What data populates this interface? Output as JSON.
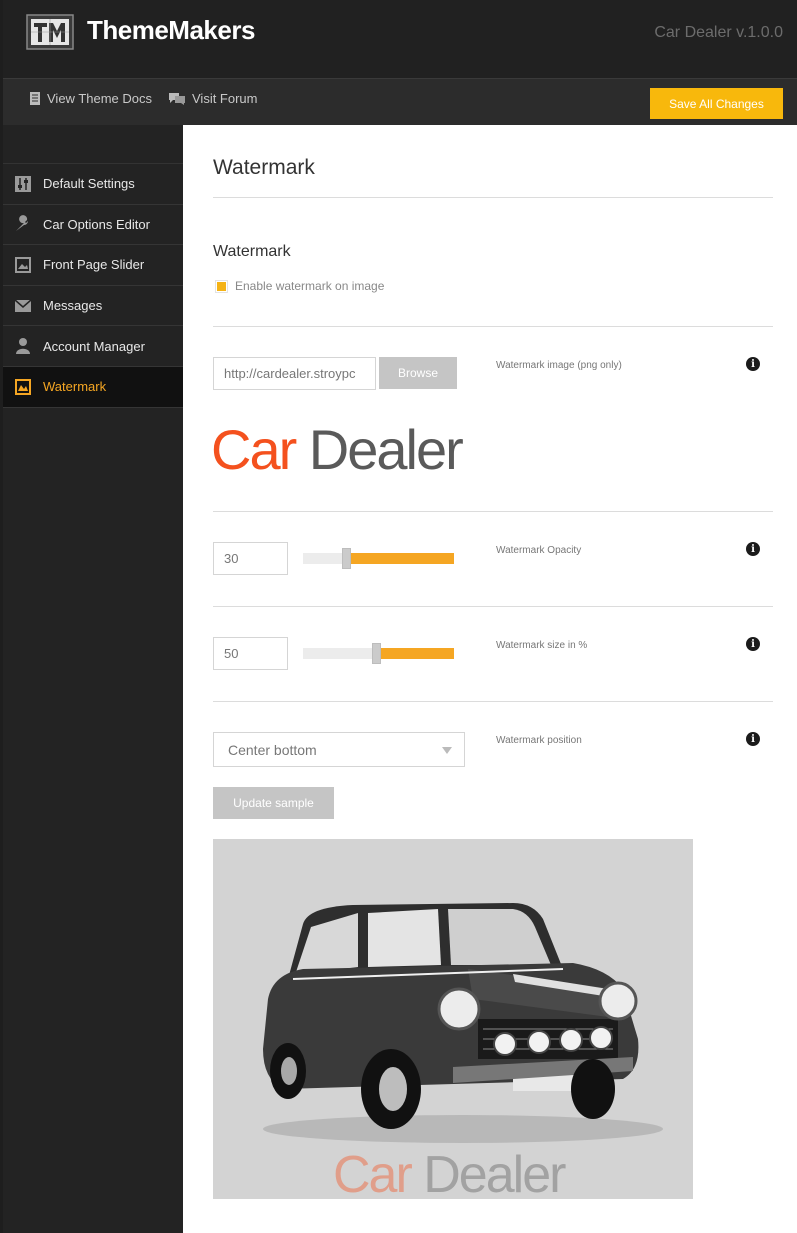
{
  "header": {
    "brand": "ThemeMakers",
    "version": "Car Dealer v.1.0.0"
  },
  "toolbar": {
    "docs_label": "View Theme Docs",
    "forum_label": "Visit Forum",
    "save_label": "Save All Changes",
    "accent": "#f8b80c"
  },
  "sidebar": {
    "items": [
      {
        "label": "Default Settings",
        "icon": "sliders-icon"
      },
      {
        "label": "Car Options Editor",
        "icon": "wrench-icon"
      },
      {
        "label": "Front Page Slider",
        "icon": "images-icon"
      },
      {
        "label": "Messages",
        "icon": "envelope-icon"
      },
      {
        "label": "Account Manager",
        "icon": "user-icon"
      },
      {
        "label": "Watermark",
        "icon": "watermark-icon",
        "active": true
      }
    ]
  },
  "main": {
    "page_title": "Watermark",
    "section_title": "Watermark",
    "enable_label": "Enable watermark on image",
    "enable_checked": true,
    "image_url": "http://cardealer.stroypc",
    "browse_label": "Browse",
    "image_field_label": "Watermark image (png only)",
    "logo": {
      "car": "Car",
      "dealer": "Dealer"
    },
    "opacity": {
      "value": "30",
      "label": "Watermark Opacity",
      "percent": 30
    },
    "size": {
      "value": "50",
      "label": "Watermark size in %",
      "percent": 50
    },
    "position": {
      "value": "Center bottom",
      "label": "Watermark position"
    },
    "update_label": "Update sample",
    "info_glyph": "i"
  }
}
